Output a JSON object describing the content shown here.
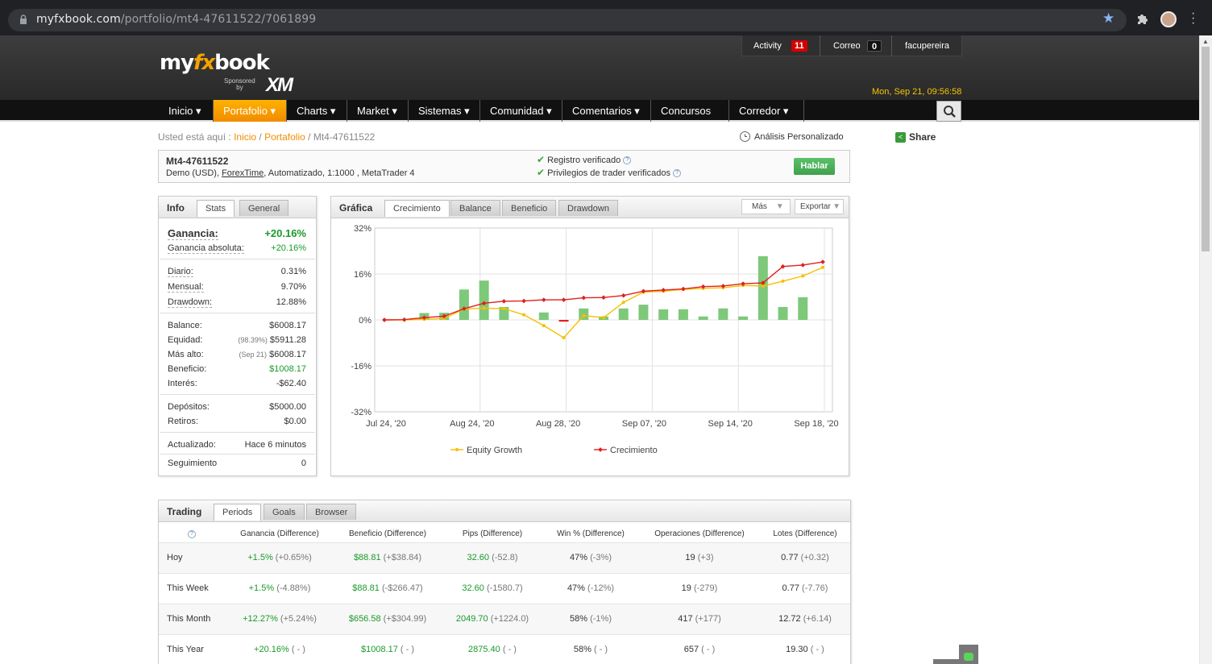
{
  "browser": {
    "url_host": "myfxbook.com",
    "url_path": "/portfolio/mt4-47611522/7061899"
  },
  "header": {
    "logo_my": "my",
    "logo_fx": "fx",
    "logo_book": "book",
    "sponsored_1": "Sponsored",
    "sponsored_2": "by",
    "sponsor": "XM",
    "activity_label": "Activity",
    "activity_count": "11",
    "mail_label": "Correo",
    "mail_count": "0",
    "username": "facupereira",
    "datetime": "Mon, Sep 21, 09:56:58"
  },
  "nav": [
    "Inicio ▾",
    "Portafolio ▾",
    "Charts ▾",
    "Market ▾",
    "Sistemas ▾",
    "Comunidad ▾",
    "Comentarios ▾",
    "Concursos ▾",
    "Corredor ▾"
  ],
  "breadcrumb": {
    "prefix": "Usted está aquí :",
    "home": "Inicio",
    "portfolio": "Portafolio",
    "current": "Mt4-47611522"
  },
  "custom_analysis": "Análisis Personalizado",
  "share": "Share",
  "account": {
    "name": "Mt4-47611522",
    "desc_1": "Demo (USD),",
    "broker": "ForexTime",
    "desc_2": ", Automatizado, 1:1000 , MetaTrader 4",
    "verified_1": "Registro verificado",
    "verified_2": "Privilegios de trader verificados",
    "talk": "Hablar"
  },
  "info": {
    "title": "Info",
    "tabs": [
      "Stats",
      "General"
    ],
    "gain_label": "Ganancia:",
    "gain_value": "+20.16%",
    "abs_gain_label": "Ganancia absoluta:",
    "abs_gain_value": "+20.16%",
    "daily_label": "Diario:",
    "daily": "0.31%",
    "monthly_label": "Mensual:",
    "monthly": "9.70%",
    "drawdown_label": "Drawdown:",
    "drawdown": "12.88%",
    "balance_label": "Balance:",
    "balance": "$6008.17",
    "equity_label": "Equidad:",
    "equity_pct": "(98.39%)",
    "equity": "$5911.28",
    "highest_label": "Más alto:",
    "highest_date": "(Sep 21)",
    "highest": "$6008.17",
    "profit_label": "Beneficio:",
    "profit": "$1008.17",
    "interest_label": "Interés:",
    "interest": "-$62.40",
    "deposits_label": "Depósitos:",
    "deposits": "$5000.00",
    "withdrawals_label": "Retiros:",
    "withdrawals": "$0.00",
    "updated_label": "Actualizado:",
    "updated": "Hace 6 minutos",
    "tracking_label": "Seguimiento",
    "tracking": "0"
  },
  "graph": {
    "title": "Gráfica",
    "tabs": [
      "Crecimiento",
      "Balance",
      "Beneficio",
      "Drawdown"
    ],
    "more": "Más",
    "export": "Exportar"
  },
  "chart_data": {
    "type": "line",
    "y_ticks": [
      "32%",
      "16%",
      "0%",
      "-16%",
      "-32%"
    ],
    "ylim": [
      -32,
      32
    ],
    "x_ticks": [
      "Jul 24, '20",
      "Aug 24, '20",
      "Aug 28, '20",
      "Sep 07, '20",
      "Sep 14, '20",
      "Sep 18, '20"
    ],
    "grid": true,
    "legend_placement": "bottom",
    "series": [
      {
        "name": "Equity Growth",
        "color": "#f5c000",
        "values": [
          0,
          0,
          0.2,
          0.5,
          3.8,
          4.1,
          3.9,
          1.8,
          -2.0,
          -6.2,
          1.5,
          0.8,
          6.1,
          9.7,
          10.0,
          10.6,
          11.0,
          11.2,
          12.0,
          11.8,
          13.5,
          15.3,
          18.3
        ]
      },
      {
        "name": "Crecimiento",
        "color": "#e02020",
        "values": [
          0,
          0.1,
          0.8,
          1.3,
          3.9,
          5.8,
          6.5,
          6.6,
          7.0,
          7.0,
          7.7,
          7.8,
          8.5,
          10.0,
          10.4,
          10.8,
          11.6,
          11.8,
          12.6,
          12.9,
          18.6,
          19.1,
          20.2
        ]
      },
      {
        "name": "",
        "color": "#7ec87a",
        "type": "bar",
        "values": [
          null,
          null,
          2.4,
          2.5,
          10.6,
          13.7,
          4.5,
          null,
          2.6,
          -0.6,
          4.0,
          1.2,
          4.0,
          5.3,
          3.7,
          3.7,
          1.2,
          4.0,
          1.2,
          22.2,
          4.5,
          7.9,
          null
        ]
      }
    ]
  },
  "trading": {
    "title": "Trading",
    "tabs": [
      "Periods",
      "Goals",
      "Browser"
    ],
    "columns": [
      "Ganancia (Difference)",
      "Beneficio (Difference)",
      "Pips (Difference)",
      "Win % (Difference)",
      "Operaciones (Difference)",
      "Lotes (Difference)"
    ],
    "rows": [
      {
        "period": "Hoy",
        "gain": "+1.5%",
        "gain_d": "(+0.65%)",
        "profit": "$88.81",
        "profit_d": "(+$38.84)",
        "pips": "32.60",
        "pips_d": "(-52.8)",
        "win": "47%",
        "win_d": "(-3%)",
        "trades": "19",
        "trades_d": "(+3)",
        "lots": "0.77",
        "lots_d": "(+0.32)"
      },
      {
        "period": "This Week",
        "gain": "+1.5%",
        "gain_d": "(-4.88%)",
        "profit": "$88.81",
        "profit_d": "(-$266.47)",
        "pips": "32.60",
        "pips_d": "(-1580.7)",
        "win": "47%",
        "win_d": "(-12%)",
        "trades": "19",
        "trades_d": "(-279)",
        "lots": "0.77",
        "lots_d": "(-7.76)"
      },
      {
        "period": "This Month",
        "gain": "+12.27%",
        "gain_d": "(+5.24%)",
        "profit": "$656.58",
        "profit_d": "(+$304.99)",
        "pips": "2049.70",
        "pips_d": "(+1224.0)",
        "win": "58%",
        "win_d": "(-1%)",
        "trades": "417",
        "trades_d": "(+177)",
        "lots": "12.72",
        "lots_d": "(+6.14)"
      },
      {
        "period": "This Year",
        "gain": "+20.16%",
        "gain_d": "( - )",
        "profit": "$1008.17",
        "profit_d": "( - )",
        "pips": "2875.40",
        "pips_d": "( - )",
        "win": "58%",
        "win_d": "( - )",
        "trades": "657",
        "trades_d": "( - )",
        "lots": "19.30",
        "lots_d": "( - )"
      }
    ]
  }
}
